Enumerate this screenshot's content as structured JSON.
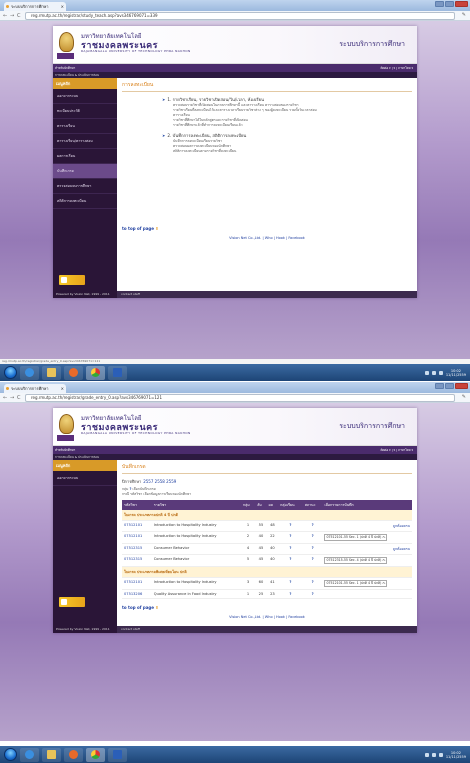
{
  "screen1": {
    "tab_title": "ระบบบริการการศึกษา",
    "url": "reg.rmutp.ac.th/registrar/study_teach.asp?avs346769071=339",
    "banner": {
      "uni_th_1": "มหาวิทยาลัยเทคโนโลยี",
      "uni_th_2": "ราชมงคลพระนคร",
      "uni_en": "RAJAMANGALA UNIVERSITY OF TECHNOLOGY PHRA NAKHON",
      "service": "ระบบบริการการศึกษา"
    },
    "topbar_left": "สำหรับนักศึกษา",
    "topbar_right": "ติดต่อ ▾ | ▾ | ภาษาไทย ▾",
    "subbar": "การลงทะเบียน & ประเมินการสอน",
    "sidebar": {
      "header": "เมนูหลัก",
      "items": [
        "ออกจากระบบ",
        "ทะเบียนประวัติ",
        "ตารางเรียน",
        "ตารางเรียน/ตารางสอบ",
        "ผลการเรียน",
        "บันทึกเกรด",
        "ตรวจสอบจบการศึกษา",
        "สถิติการลงทะเบียน"
      ],
      "active_index": 5
    },
    "page_title": "การลงทะเบียน",
    "sections": [
      {
        "heading": "1. รายวิชาเรียน, รายวิชาเปิดสอน/วัน/เวลา, ห้องเรียน",
        "lines": [
          "ตรวจสอบรายวิชาที่เปิดสอนในภาคการศึกษานี้ และตารางเรียน ตารางสอบของรายวิชา",
          "รายวิชาเรียนที่ลงทะเบียนไว้และตารางเวลาเรียนรายวิชาต่าง ๆ ของผู้ลงทะเบียน รวมทั้งวันเวลาสอบ",
          "ตารางเรียน",
          "รายวิชาที่ศึกษาได้ในหลักสูตรและรายวิชาที่เปิดสอน",
          "รายวิชาที่ศึกษาแล้วที่ทำการลงทะเบียนเรียนแล้ว"
        ]
      },
      {
        "heading": "2. บันทึกการลงทะเบียน, สถิติการลงทะเบียน",
        "lines": [
          "บันทึกการลงทะเบียนเรียนรายวิชา",
          "ตรวจสอบผลการลงทะเบียนของนักศึกษา",
          "สถิติการลงทะเบียนตามรายวิชาที่ลงทะเบียน"
        ]
      }
    ],
    "top_link": "to top of page",
    "footer_links": "Vision Net Co.,Ltd. | Who | Hook | Facebook",
    "footer_left": "Powered by Vision Net, 1999 - 2011",
    "footer_right": "contact staff",
    "status_bar": "reg.rmutp.ac.th/registrar/grade_entry_0.asp?avs346769071=121"
  },
  "screen2": {
    "tab_title": "ระบบบริการการศึกษา",
    "url": "reg.rmutp.ac.th/registrar/grade_entry_0.asp?avs346769071=121",
    "sidebar": {
      "header": "เมนูหลัก",
      "items": [
        "ออกจากระบบ"
      ],
      "active_index": -1
    },
    "page_title": "บันทึกเกรด",
    "semester_label": "ปีการศึกษา",
    "semester_values": "2557  2558  2559",
    "legend_1": "กลุ่ม",
    "legend_icon": "?",
    "legend_1_text": "เลือกบันทึกเกรด",
    "legend_2": "กรณี รหัสวิชา เลือกข้อมูลการเรียนของนักศึกษา",
    "columns": [
      "รหัสวิชา",
      "รายวิชา",
      "กลุ่ม",
      "ลับ",
      "ผล",
      "กลุ่มเรียน",
      "สถานะ",
      "",
      "เลือกรายการบันทึก"
    ],
    "groups": [
      {
        "label": "ใบเกรด   ประเภทภาคปกติ 4 ปี ปกติ",
        "rows": [
          {
            "code": "07512101",
            "name": "Introduction to Hospitality Industry",
            "sec": "1",
            "a": "55",
            "b": "48",
            "st": "?",
            "st2": "?",
            "sel": "",
            "note": "ถูกต้องครบ"
          },
          {
            "code": "07512101",
            "name": "Introduction to Hospitality Industry",
            "sec": "2",
            "a": "40",
            "b": "22",
            "st": "?",
            "st2": "?",
            "sel": "07512101-55 Sec. 1 (ปกติ 4 ปี ปกติ) ภ.",
            "note": ""
          },
          {
            "code": "07512315",
            "name": "Consumer Behavior",
            "sec": "4",
            "a": "45",
            "b": "40",
            "st": "?",
            "st2": "?",
            "sel": "",
            "note": "ถูกต้องครบ"
          },
          {
            "code": "07512315",
            "name": "Consumer Behavior",
            "sec": "5",
            "a": "45",
            "b": "40",
            "st": "?",
            "st2": "?",
            "sel": "07512315-55 Sec. 4 (ปกติ 4 ปี ปกติ) ภ.",
            "note": ""
          }
        ]
      },
      {
        "label": "ใบเกรด   ประเภทภาคพิเศษเทียบโอน ปกติ",
        "rows": [
          {
            "code": "07512101",
            "name": "Introduction to Hospitality Industry",
            "sec": "3",
            "a": "60",
            "b": "41",
            "st": "?",
            "st2": "?",
            "sel": "07512101-55 Sec. 1 (ปกติ 4 ปี ปกติ) ภ.",
            "note": ""
          },
          {
            "code": "07513206",
            "name": "Quality Assurance in Food Industry",
            "sec": "1",
            "a": "25",
            "b": "23",
            "st": "?",
            "st2": "?",
            "sel": "",
            "note": ""
          }
        ]
      }
    ],
    "top_link": "to top of page",
    "footer_links": "Vision Net Co.,Ltd. | Who | Hook | Facebook",
    "footer_left": "Powered by Vision Net, 1999 - 2011",
    "footer_right": "contact staff"
  },
  "taskbar": {
    "time": "10:02",
    "date": "11/11/2559"
  },
  "colors": {
    "accent": "#4a2b6c",
    "orange": "#d89a28",
    "link": "#2040a0"
  }
}
